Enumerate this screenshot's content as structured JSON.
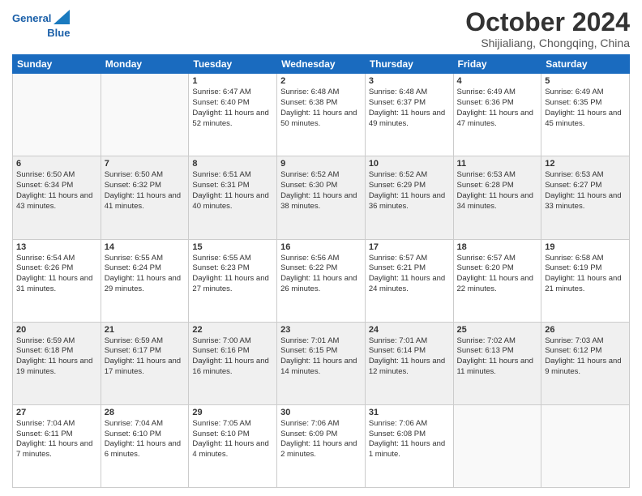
{
  "header": {
    "logo_line1": "General",
    "logo_line2": "Blue",
    "title": "October 2024",
    "subtitle": "Shijialiang, Chongqing, China"
  },
  "weekdays": [
    "Sunday",
    "Monday",
    "Tuesday",
    "Wednesday",
    "Thursday",
    "Friday",
    "Saturday"
  ],
  "weeks": [
    [
      {
        "day": "",
        "info": ""
      },
      {
        "day": "",
        "info": ""
      },
      {
        "day": "1",
        "info": "Sunrise: 6:47 AM\nSunset: 6:40 PM\nDaylight: 11 hours and 52 minutes."
      },
      {
        "day": "2",
        "info": "Sunrise: 6:48 AM\nSunset: 6:38 PM\nDaylight: 11 hours and 50 minutes."
      },
      {
        "day": "3",
        "info": "Sunrise: 6:48 AM\nSunset: 6:37 PM\nDaylight: 11 hours and 49 minutes."
      },
      {
        "day": "4",
        "info": "Sunrise: 6:49 AM\nSunset: 6:36 PM\nDaylight: 11 hours and 47 minutes."
      },
      {
        "day": "5",
        "info": "Sunrise: 6:49 AM\nSunset: 6:35 PM\nDaylight: 11 hours and 45 minutes."
      }
    ],
    [
      {
        "day": "6",
        "info": "Sunrise: 6:50 AM\nSunset: 6:34 PM\nDaylight: 11 hours and 43 minutes."
      },
      {
        "day": "7",
        "info": "Sunrise: 6:50 AM\nSunset: 6:32 PM\nDaylight: 11 hours and 41 minutes."
      },
      {
        "day": "8",
        "info": "Sunrise: 6:51 AM\nSunset: 6:31 PM\nDaylight: 11 hours and 40 minutes."
      },
      {
        "day": "9",
        "info": "Sunrise: 6:52 AM\nSunset: 6:30 PM\nDaylight: 11 hours and 38 minutes."
      },
      {
        "day": "10",
        "info": "Sunrise: 6:52 AM\nSunset: 6:29 PM\nDaylight: 11 hours and 36 minutes."
      },
      {
        "day": "11",
        "info": "Sunrise: 6:53 AM\nSunset: 6:28 PM\nDaylight: 11 hours and 34 minutes."
      },
      {
        "day": "12",
        "info": "Sunrise: 6:53 AM\nSunset: 6:27 PM\nDaylight: 11 hours and 33 minutes."
      }
    ],
    [
      {
        "day": "13",
        "info": "Sunrise: 6:54 AM\nSunset: 6:26 PM\nDaylight: 11 hours and 31 minutes."
      },
      {
        "day": "14",
        "info": "Sunrise: 6:55 AM\nSunset: 6:24 PM\nDaylight: 11 hours and 29 minutes."
      },
      {
        "day": "15",
        "info": "Sunrise: 6:55 AM\nSunset: 6:23 PM\nDaylight: 11 hours and 27 minutes."
      },
      {
        "day": "16",
        "info": "Sunrise: 6:56 AM\nSunset: 6:22 PM\nDaylight: 11 hours and 26 minutes."
      },
      {
        "day": "17",
        "info": "Sunrise: 6:57 AM\nSunset: 6:21 PM\nDaylight: 11 hours and 24 minutes."
      },
      {
        "day": "18",
        "info": "Sunrise: 6:57 AM\nSunset: 6:20 PM\nDaylight: 11 hours and 22 minutes."
      },
      {
        "day": "19",
        "info": "Sunrise: 6:58 AM\nSunset: 6:19 PM\nDaylight: 11 hours and 21 minutes."
      }
    ],
    [
      {
        "day": "20",
        "info": "Sunrise: 6:59 AM\nSunset: 6:18 PM\nDaylight: 11 hours and 19 minutes."
      },
      {
        "day": "21",
        "info": "Sunrise: 6:59 AM\nSunset: 6:17 PM\nDaylight: 11 hours and 17 minutes."
      },
      {
        "day": "22",
        "info": "Sunrise: 7:00 AM\nSunset: 6:16 PM\nDaylight: 11 hours and 16 minutes."
      },
      {
        "day": "23",
        "info": "Sunrise: 7:01 AM\nSunset: 6:15 PM\nDaylight: 11 hours and 14 minutes."
      },
      {
        "day": "24",
        "info": "Sunrise: 7:01 AM\nSunset: 6:14 PM\nDaylight: 11 hours and 12 minutes."
      },
      {
        "day": "25",
        "info": "Sunrise: 7:02 AM\nSunset: 6:13 PM\nDaylight: 11 hours and 11 minutes."
      },
      {
        "day": "26",
        "info": "Sunrise: 7:03 AM\nSunset: 6:12 PM\nDaylight: 11 hours and 9 minutes."
      }
    ],
    [
      {
        "day": "27",
        "info": "Sunrise: 7:04 AM\nSunset: 6:11 PM\nDaylight: 11 hours and 7 minutes."
      },
      {
        "day": "28",
        "info": "Sunrise: 7:04 AM\nSunset: 6:10 PM\nDaylight: 11 hours and 6 minutes."
      },
      {
        "day": "29",
        "info": "Sunrise: 7:05 AM\nSunset: 6:10 PM\nDaylight: 11 hours and 4 minutes."
      },
      {
        "day": "30",
        "info": "Sunrise: 7:06 AM\nSunset: 6:09 PM\nDaylight: 11 hours and 2 minutes."
      },
      {
        "day": "31",
        "info": "Sunrise: 7:06 AM\nSunset: 6:08 PM\nDaylight: 11 hours and 1 minute."
      },
      {
        "day": "",
        "info": ""
      },
      {
        "day": "",
        "info": ""
      }
    ]
  ]
}
